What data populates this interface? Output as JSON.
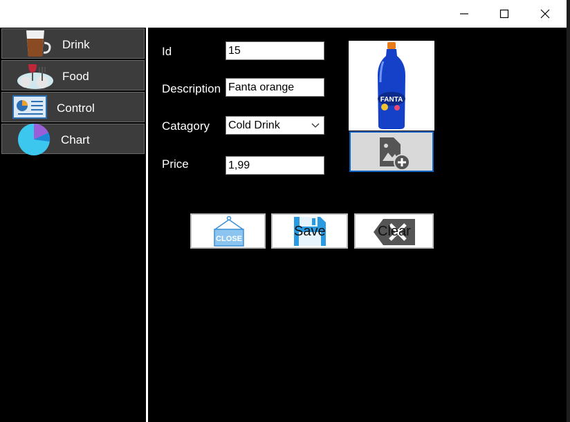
{
  "titlebar": {
    "minimize_icon": "minimize-icon",
    "maximize_icon": "maximize-icon",
    "close_icon": "close-icon"
  },
  "sidebar": {
    "items": [
      {
        "label": "Drink",
        "icon": "coffee-cup-icon"
      },
      {
        "label": "Food",
        "icon": "food-icon"
      },
      {
        "label": "Control",
        "icon": "dashboard-icon"
      },
      {
        "label": "Chart",
        "icon": "pie-chart-icon"
      }
    ]
  },
  "form": {
    "id_label": "Id",
    "id_value": "15",
    "description_label": "Description",
    "description_value": "Fanta orange",
    "category_label": "Catagory",
    "category_value": "Cold Drink",
    "price_label": "Price",
    "price_value": "1,99"
  },
  "image": {
    "product_image": "soda-bottle-image",
    "add_image_icon": "add-image-icon"
  },
  "actions": {
    "close_sign_text": "CLOSE",
    "save_label": "Save",
    "clear_label": "Clear"
  },
  "colors": {
    "accent": "#0a64c8",
    "nav_bg": "#3c3c3c",
    "bottle_blue": "#1540c8"
  }
}
